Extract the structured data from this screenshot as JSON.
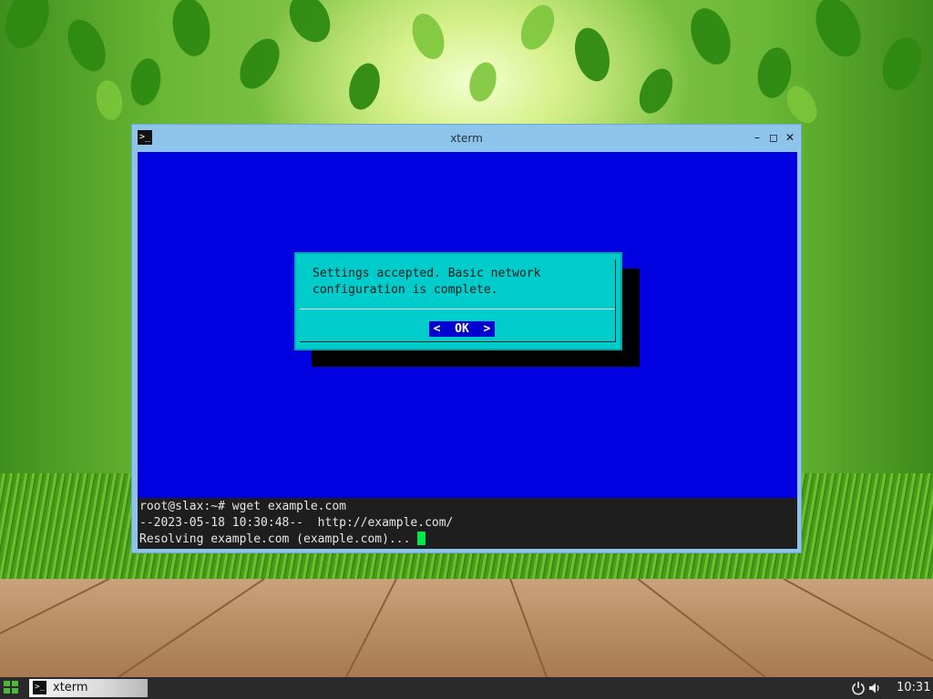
{
  "window": {
    "title": "xterm",
    "icon": "terminal-icon",
    "controls": [
      "minimize-icon",
      "maximize-icon",
      "close-icon"
    ]
  },
  "dialog": {
    "message_line1": "Settings accepted. Basic network",
    "message_line2": "configuration is complete.",
    "ok_label": "<  OK  >"
  },
  "terminal": {
    "line1": "root@slax:~# wget example.com",
    "line2": "--2023-05-18 10:30:48--  http://example.com/",
    "line3": "Resolving example.com (example.com)... "
  },
  "taskbar": {
    "start_icon": "apps-grid-icon",
    "task_label": "xterm",
    "tray": [
      "power-icon",
      "volume-icon"
    ],
    "clock": "10:31"
  },
  "colors": {
    "dialog_background": "#0000e0",
    "dialog_box": "#00cccc",
    "cursor": "#00e84a",
    "window_frame": "#8fc4ea",
    "taskbar": "#2a2a2a"
  }
}
